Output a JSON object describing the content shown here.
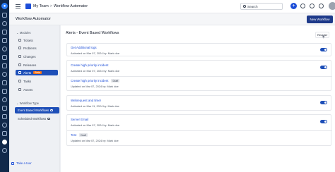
{
  "header": {
    "team": "My Team",
    "separator": ">",
    "app": "Workflow Automator",
    "search_label": "Search"
  },
  "page": {
    "title": "Workflow Automator",
    "new_button": "New Workflow"
  },
  "sidebar": {
    "modules_label": "Modules",
    "items": [
      {
        "label": "Tickets"
      },
      {
        "label": "Problems"
      },
      {
        "label": "Changes"
      },
      {
        "label": "Releases"
      },
      {
        "label": "Alerts",
        "badge": "Beta"
      },
      {
        "label": "Tasks"
      },
      {
        "label": "Assets"
      }
    ],
    "workflow_type_label": "Workflow Type",
    "workflow_types": [
      {
        "label": "Event Based Workflows"
      },
      {
        "label": "Scheduled Workflows"
      }
    ],
    "tour": "Take a tour"
  },
  "main": {
    "heading": "Alerts - Event Based Workflows",
    "reorder": "Reorder",
    "workflows": [
      {
        "name": "Get Additional logs",
        "meta": "Activated on Mar 07, 2024 by: Mark doe",
        "enabled": true
      },
      {
        "name": "Create high priority incident",
        "meta": "Activated on Mar 07, 2024 by: Mark doe",
        "enabled": true
      },
      {
        "name": "Create high priority incident",
        "badge": "Draft",
        "meta": "Updated on Mar 07, 2024 by: Mark doe",
        "enabled": false
      },
      {
        "name": "Webrequest and timer",
        "meta": "Activated on Mar 11, 2024 by: Mark doe",
        "enabled": true
      },
      {
        "name": "Server Email",
        "meta": "Activated on Mar 07, 2024 by: Mark doe",
        "enabled": true
      },
      {
        "name": "Test",
        "badge": "Draft",
        "meta": "Updated on Mar 07, 2024 by: Mark doe",
        "enabled": false
      }
    ]
  }
}
